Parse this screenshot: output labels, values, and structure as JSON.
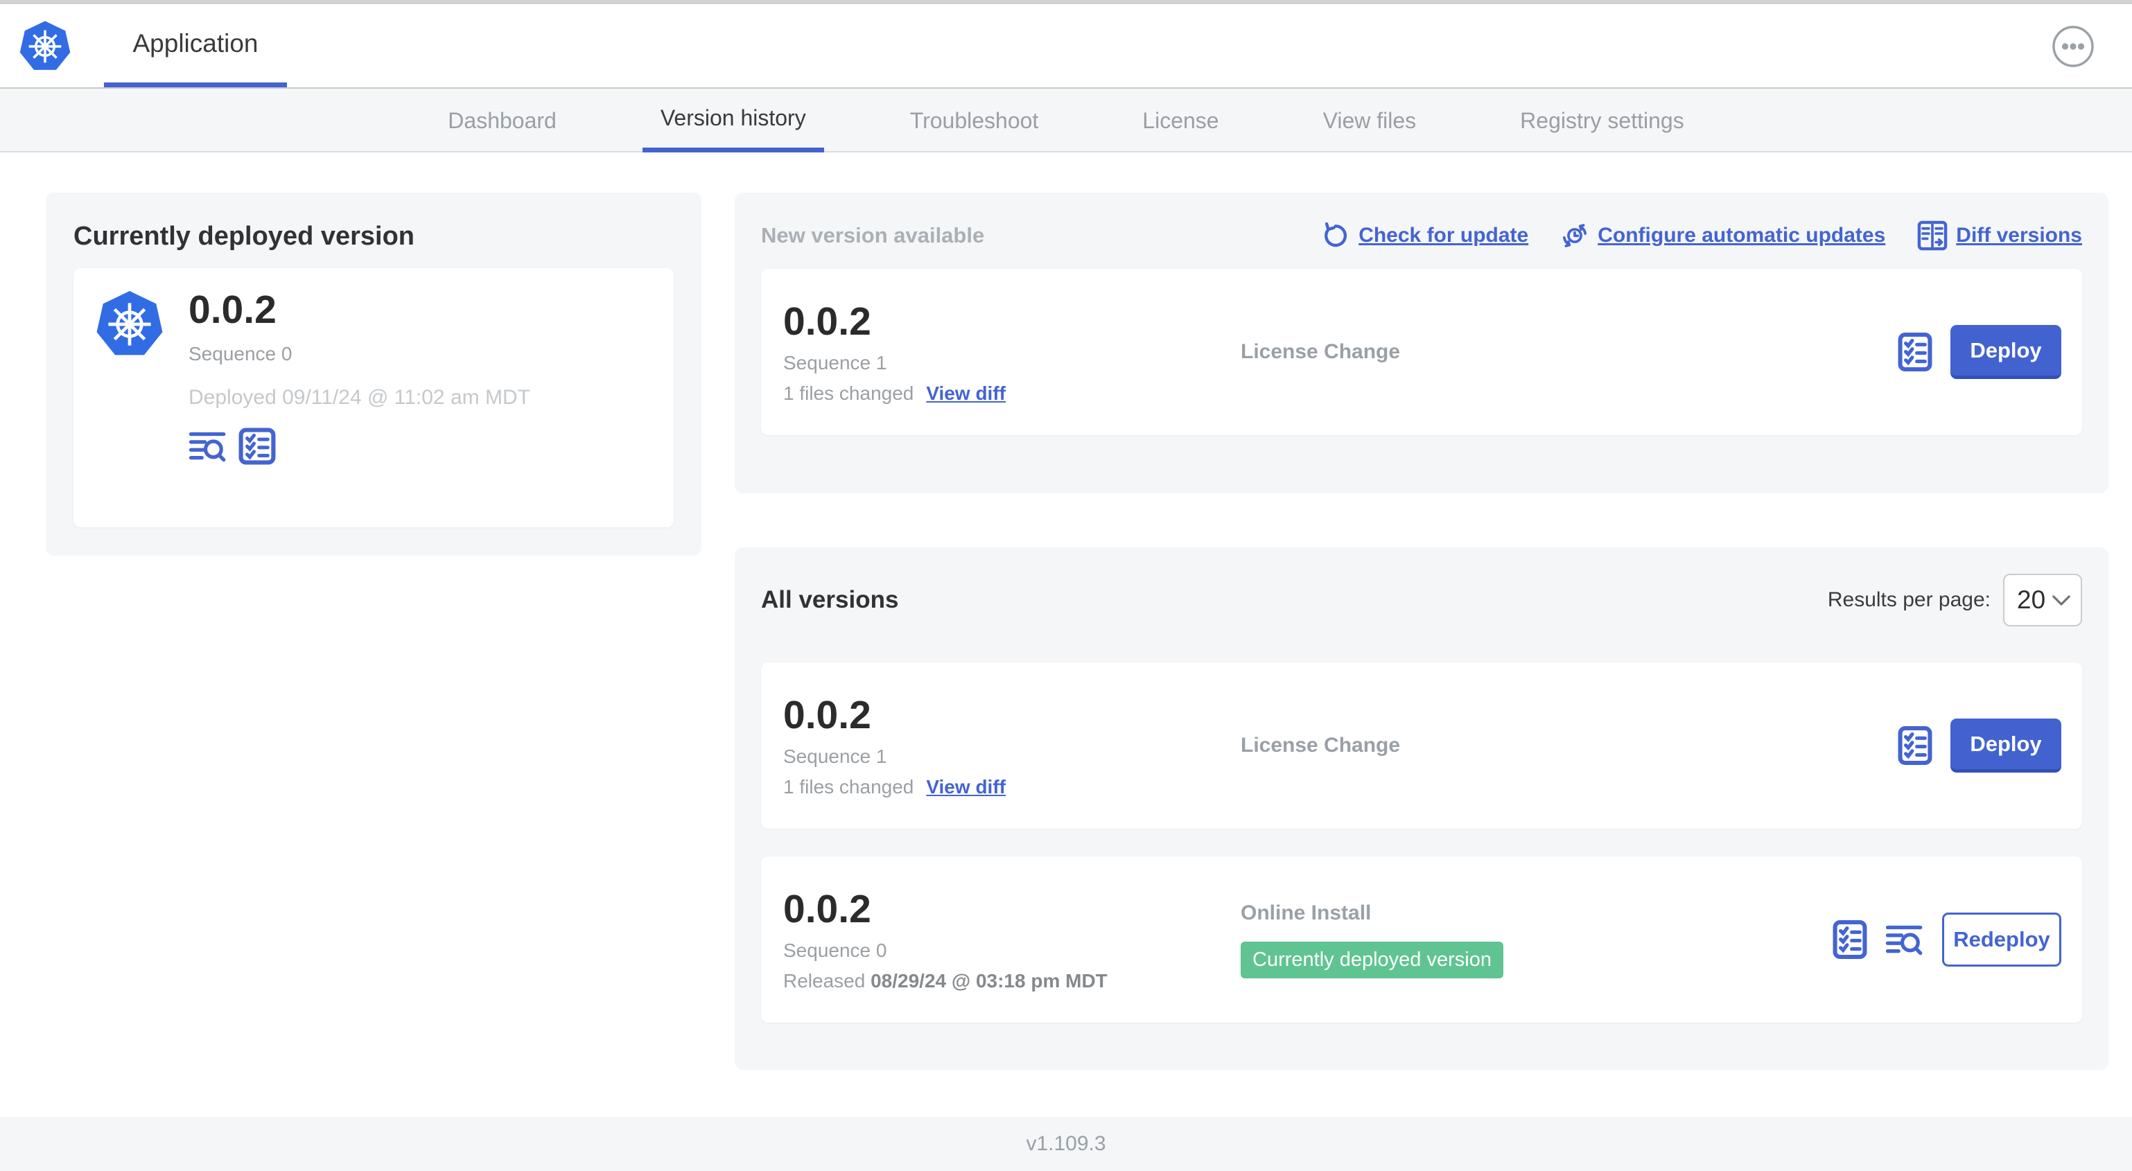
{
  "colors": {
    "primary_blue": "#4464d1",
    "button_blue": "#4263cf",
    "k8s_logo_blue": "#326ce5",
    "badge_green": "#5fc492",
    "card_gray": "#f4f6f8",
    "muted_text": "#9b9fa3"
  },
  "header": {
    "app_tab": "Application",
    "logo_icon": "kubernetes-logo",
    "menu_icon": "ellipsis-menu-icon"
  },
  "nav": {
    "tabs": [
      "Dashboard",
      "Version history",
      "Troubleshoot",
      "License",
      "View files",
      "Registry settings"
    ],
    "active_tab": "Version history"
  },
  "current": {
    "title": "Currently deployed version",
    "version": "0.0.2",
    "sequence": "Sequence 0",
    "deployed": "Deployed 09/11/24 @ 11:02 am MDT",
    "icons": [
      "logs-icon",
      "checklist-icon"
    ]
  },
  "new_version": {
    "title": "New version available",
    "actions": [
      {
        "label": "Check for update",
        "icon": "refresh-icon"
      },
      {
        "label": "Configure automatic updates",
        "icon": "auto-update-clock-icon"
      },
      {
        "label": "Diff versions",
        "icon": "diff-icon"
      }
    ],
    "row": {
      "version": "0.0.2",
      "sequence": "Sequence 1",
      "files_changed": "1 files changed",
      "view_diff": "View diff",
      "source": "License Change",
      "action": "Deploy",
      "icons": [
        "checklist-icon"
      ]
    }
  },
  "all_versions": {
    "title": "All versions",
    "results_per_page_label": "Results per page:",
    "results_per_page_value": "20",
    "rows": [
      {
        "version": "0.0.2",
        "sequence": "Sequence 1",
        "files_changed": "1 files changed",
        "view_diff": "View diff",
        "source": "License Change",
        "action": "Deploy",
        "icons": [
          "checklist-icon"
        ]
      },
      {
        "version": "0.0.2",
        "sequence": "Sequence 0",
        "released_label": "Released",
        "released_date": "08/29/24 @ 03:18 pm MDT",
        "source": "Online Install",
        "badge": "Currently deployed version",
        "action": "Redeploy",
        "icons": [
          "checklist-icon",
          "logs-icon"
        ]
      }
    ]
  },
  "footer": {
    "version": "v1.109.3"
  }
}
